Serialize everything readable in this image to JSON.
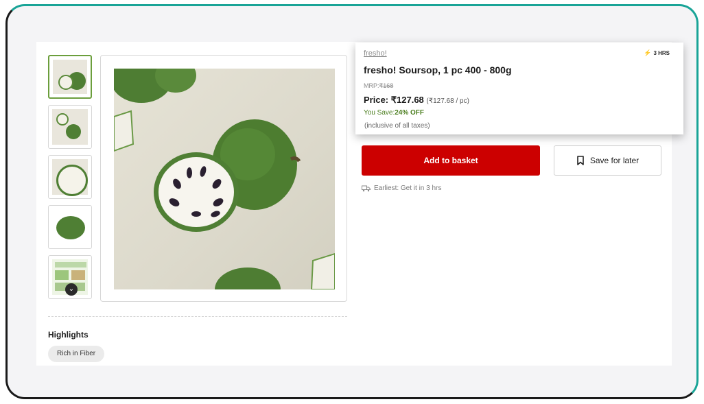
{
  "product": {
    "brand": "fresho!",
    "title": "fresho! Soursop, 1 pc 400 - 800g",
    "eta_badge": "3 HRS",
    "mrp_label": "MRP:",
    "mrp_value": "₹168",
    "price_label": "Price: ₹127.68",
    "unit_price": "(₹127.68 / pc)",
    "save_label": "You Save:",
    "save_value": "24% OFF",
    "tax_note": "(inclusive of all taxes)"
  },
  "actions": {
    "add_label": "Add to basket",
    "save_for_later_label": "Save for later",
    "delivery_text": "Earliest: Get it in 3 hrs"
  },
  "highlights": {
    "title": "Highlights",
    "chips": [
      "Rich in Fiber"
    ]
  },
  "gallery": {
    "thumbnail_count": 5,
    "active_index": 0
  },
  "icons": {
    "bolt": "lightning-icon",
    "bookmark": "bookmark-icon",
    "delivery": "delivery-truck-icon",
    "scroll": "chevron-down-icon"
  },
  "colors": {
    "primary": "#cc0000",
    "success_green": "#4a7d1d",
    "frame_teal": "#19a497"
  }
}
